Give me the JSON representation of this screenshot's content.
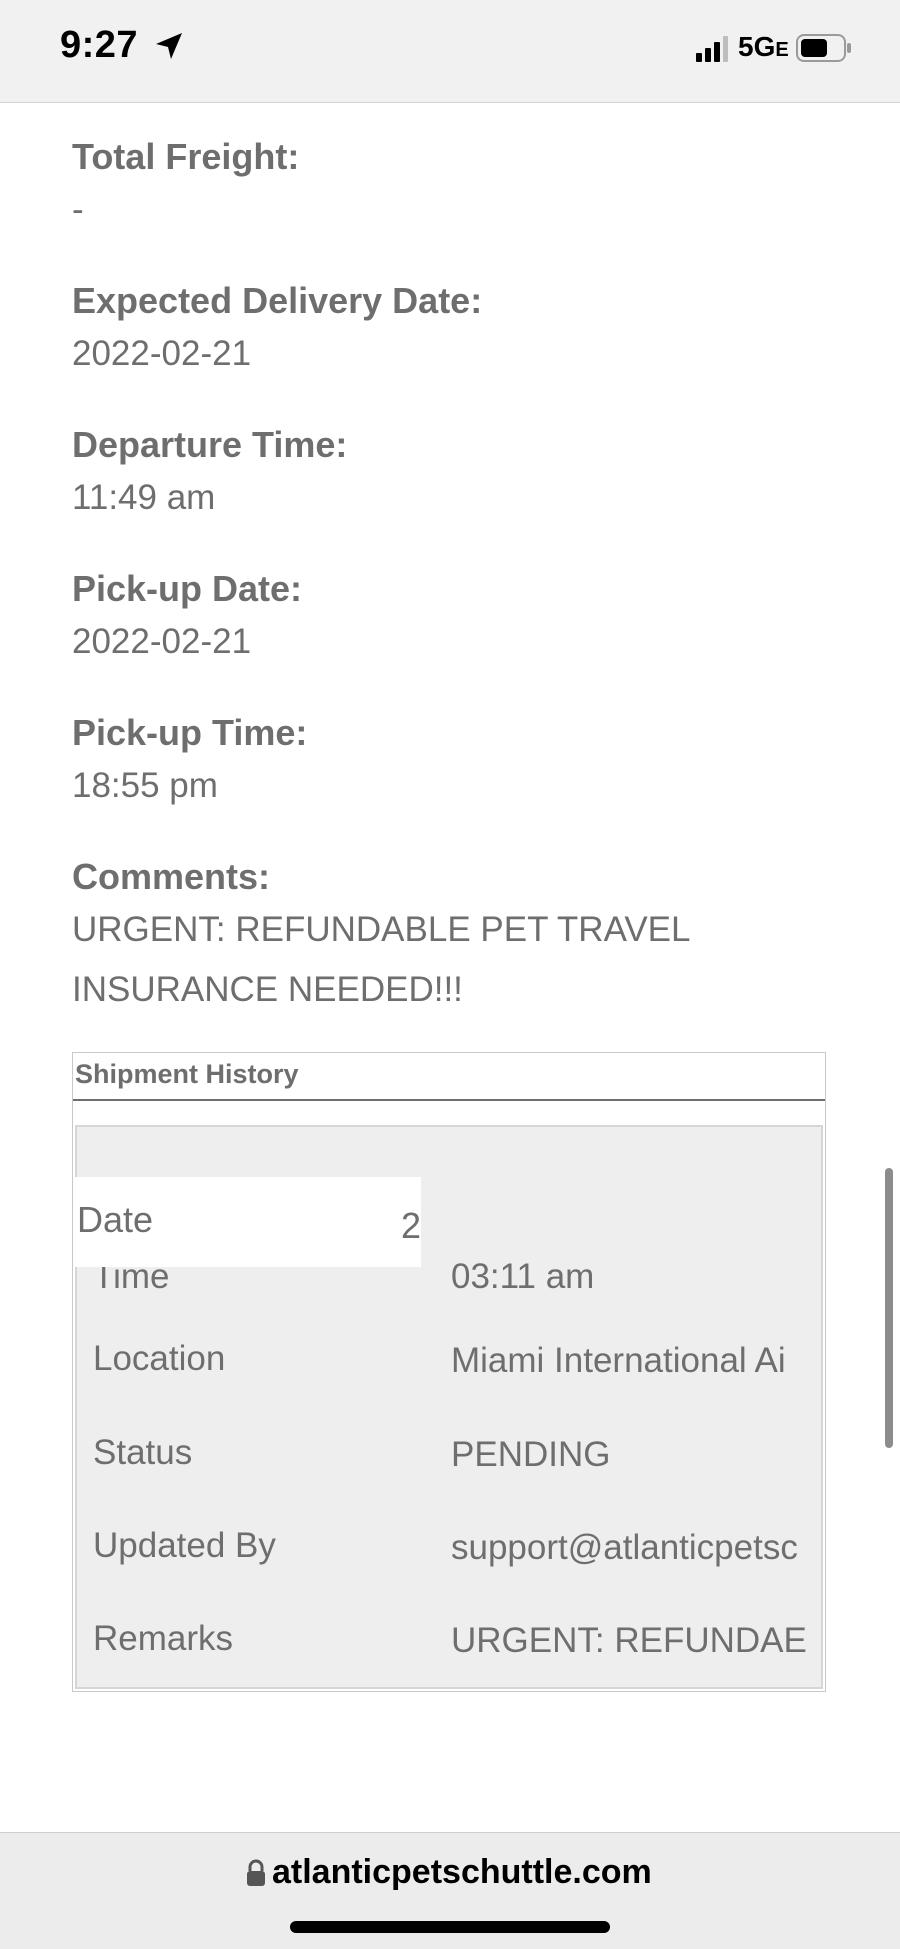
{
  "status_bar": {
    "time": "9:27",
    "network": "5G",
    "network_suffix": "E"
  },
  "fields": [
    {
      "label": "Total Freight:",
      "value": "-"
    },
    {
      "label": "Expected Delivery Date:",
      "value": "2022-02-21"
    },
    {
      "label": "Departure Time:",
      "value": "11:49 am"
    },
    {
      "label": "Pick-up Date:",
      "value": "2022-02-21"
    },
    {
      "label": "Pick-up Time:",
      "value": "18:55 pm"
    }
  ],
  "comments": {
    "label": "Comments:",
    "value": "URGENT: REFUNDABLE PET TRAVEL INSURANCE NEEDED!!!"
  },
  "shipment_history": {
    "title": "Shipment History",
    "sticky_header": {
      "label": "Date",
      "value_fragment": "2"
    },
    "rows": [
      {
        "label": "Time",
        "value": "03:11 am"
      },
      {
        "label": "Location",
        "value": "Miami International Ai"
      },
      {
        "label": "Status",
        "value": "PENDING"
      },
      {
        "label": "Updated By",
        "value": "support@atlanticpetsc"
      },
      {
        "label": "Remarks",
        "value": "URGENT: REFUNDAE"
      }
    ]
  },
  "browser": {
    "url": "atlanticpetschuttle.com"
  }
}
